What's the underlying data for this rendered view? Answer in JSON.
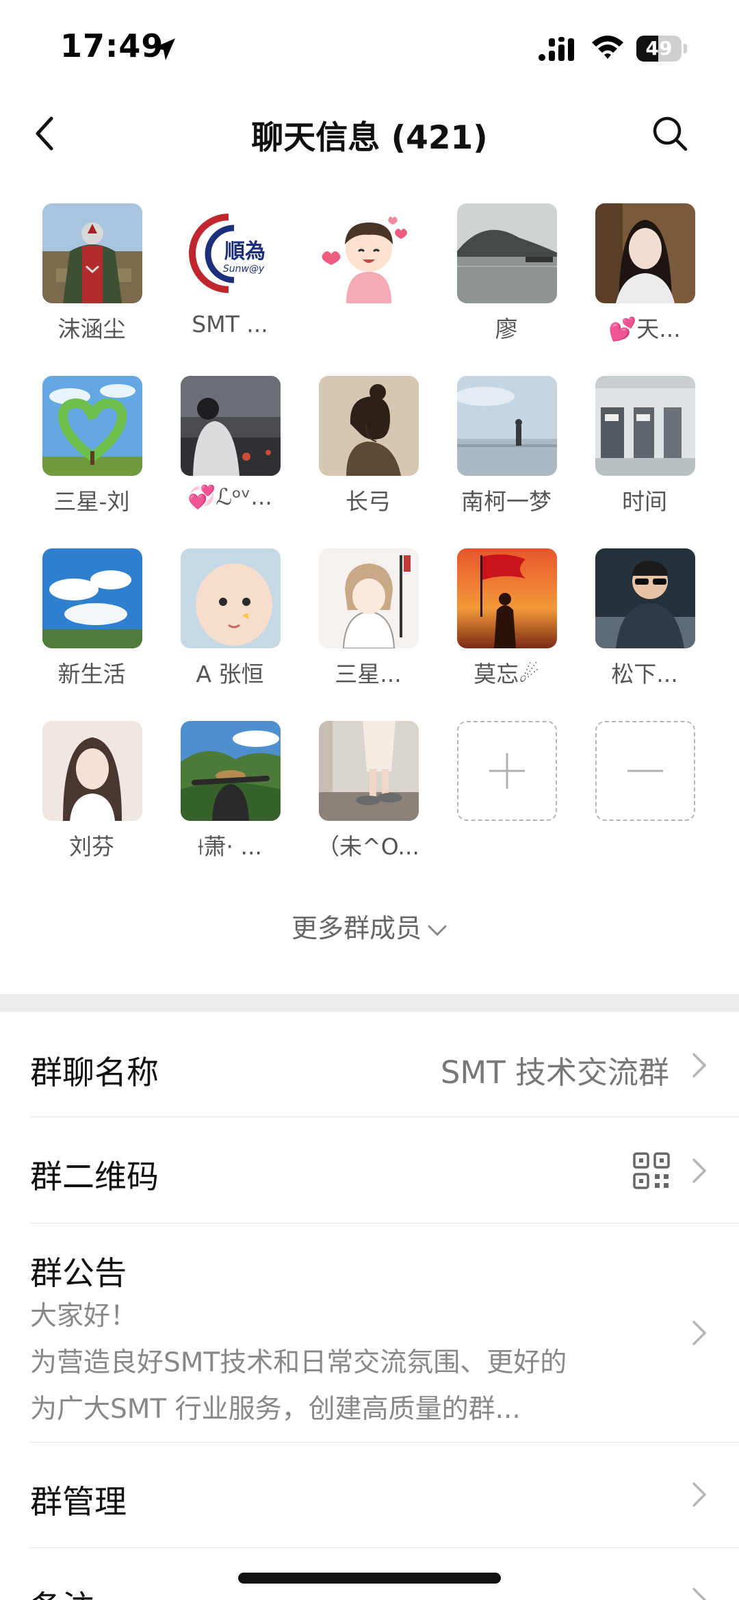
{
  "status_bar": {
    "time": "17:49",
    "battery_level": "49",
    "battery_fraction": 0.49,
    "icons": [
      "location-arrow-icon",
      "cellular-signal-icon",
      "wifi-icon",
      "battery-icon"
    ]
  },
  "nav": {
    "title": "聊天信息 (421)",
    "back_icon": "chevron-left-icon",
    "search_icon": "search-icon"
  },
  "members": [
    {
      "name": "沫涵尘"
    },
    {
      "name": "SMT ..."
    },
    {
      "name": ""
    },
    {
      "name": "廖"
    },
    {
      "name": "💕天..."
    },
    {
      "name": "三星-刘"
    },
    {
      "name": "💞ℒᵒᵛ..."
    },
    {
      "name": "长弓"
    },
    {
      "name": "南柯一梦"
    },
    {
      "name": "时间"
    },
    {
      "name": "新生活"
    },
    {
      "name": "A 张恒"
    },
    {
      "name": "三星..."
    },
    {
      "name": "莫忘☄"
    },
    {
      "name": "松下..."
    },
    {
      "name": "刘芬"
    },
    {
      "name": "⟊萧· ..."
    },
    {
      "name": "（未^O..."
    }
  ],
  "avatar_texts": {
    "logo_text": "順為",
    "logo_subtext": "Sunw@y"
  },
  "member_actions": {
    "add_icon": "plus-icon",
    "remove_icon": "minus-icon"
  },
  "more_members": {
    "label": "更多群成员",
    "icon": "chevron-down-icon"
  },
  "settings": {
    "group_name": {
      "label": "群聊名称",
      "value": "SMT 技术交流群"
    },
    "group_qr": {
      "label": "群二维码",
      "icon": "qr-code-icon"
    },
    "announcement": {
      "label": "群公告",
      "lines": [
        "大家好！",
        "为营造良好SMT技术和日常交流氛围、更好的",
        "为广大SMT 行业服务，创建高质量的群..."
      ]
    },
    "group_manage": {
      "label": "群管理"
    },
    "remark": {
      "label": "备注"
    }
  },
  "colors": {
    "section_gap": "#ececec",
    "divider": "#e4e4e4",
    "secondary_text": "#777777"
  }
}
